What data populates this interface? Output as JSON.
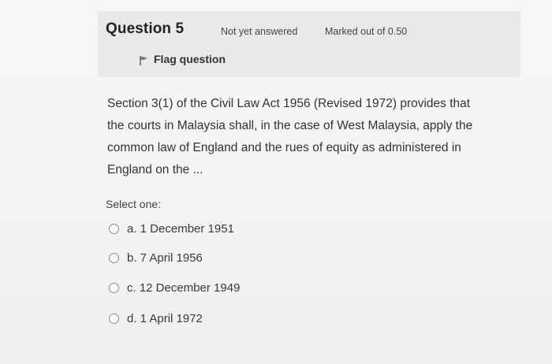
{
  "question": {
    "title": "Question 5",
    "status": "Not yet answered",
    "marks": "Marked out of 0.50",
    "flag_label": "Flag question",
    "flag_icon": "flag-icon",
    "text": "Section 3(1) of the Civil Law Act 1956 (Revised 1972) provides that the courts in Malaysia shall, in the case of West Malaysia, apply the common law of England and the rues of equity as administered in England on the ..."
  },
  "answer": {
    "prompt": "Select one:",
    "options": [
      {
        "label": "a. 1 December 1951",
        "selected": false
      },
      {
        "label": "b. 7 April 1956",
        "selected": false
      },
      {
        "label": "c. 12 December 1949",
        "selected": false
      },
      {
        "label": "d. 1 April 1972",
        "selected": false
      }
    ]
  }
}
